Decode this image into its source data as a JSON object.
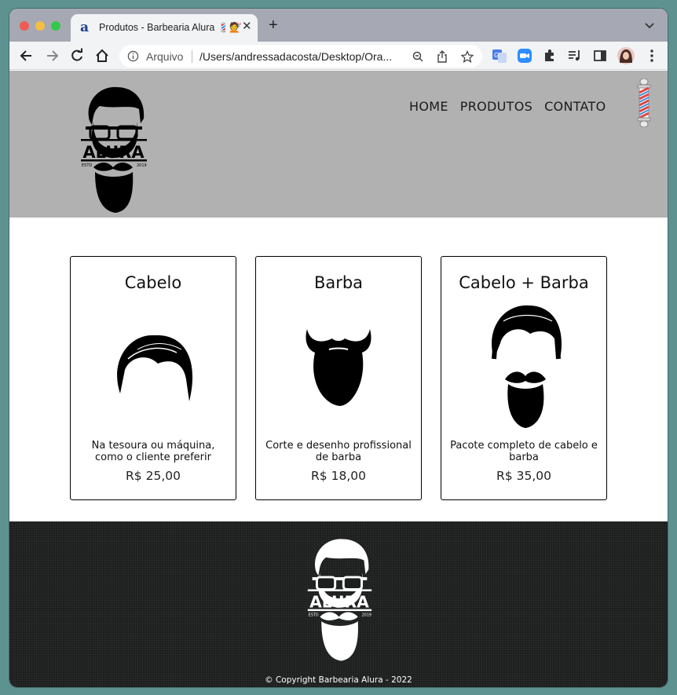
{
  "browser": {
    "tab": {
      "title": "Produtos - Barbearia Alura 💈💇",
      "favicon_letter": "a",
      "close_icon": "close-icon"
    },
    "new_tab_label": "+",
    "address_bar": {
      "scheme_label": "Arquivo",
      "url": "/Users/andressadacosta/Desktop/Ora..."
    }
  },
  "site": {
    "logo_text": "ALURA",
    "logo_left": "ESTD",
    "logo_right": "2019",
    "nav": [
      "HOME",
      "PRODUTOS",
      "CONTATO"
    ]
  },
  "products": [
    {
      "title": "Cabelo",
      "description": "Na tesoura ou máquina, como o cliente preferir",
      "price": "R$ 25,00"
    },
    {
      "title": "Barba",
      "description": "Corte e desenho profissional de barba",
      "price": "R$ 18,00"
    },
    {
      "title": "Cabelo + Barba",
      "description": "Pacote completo de cabelo e barba",
      "price": "R$ 35,00"
    }
  ],
  "footer": {
    "copyright": "© Copyright Barbearia Alura - 2022"
  }
}
